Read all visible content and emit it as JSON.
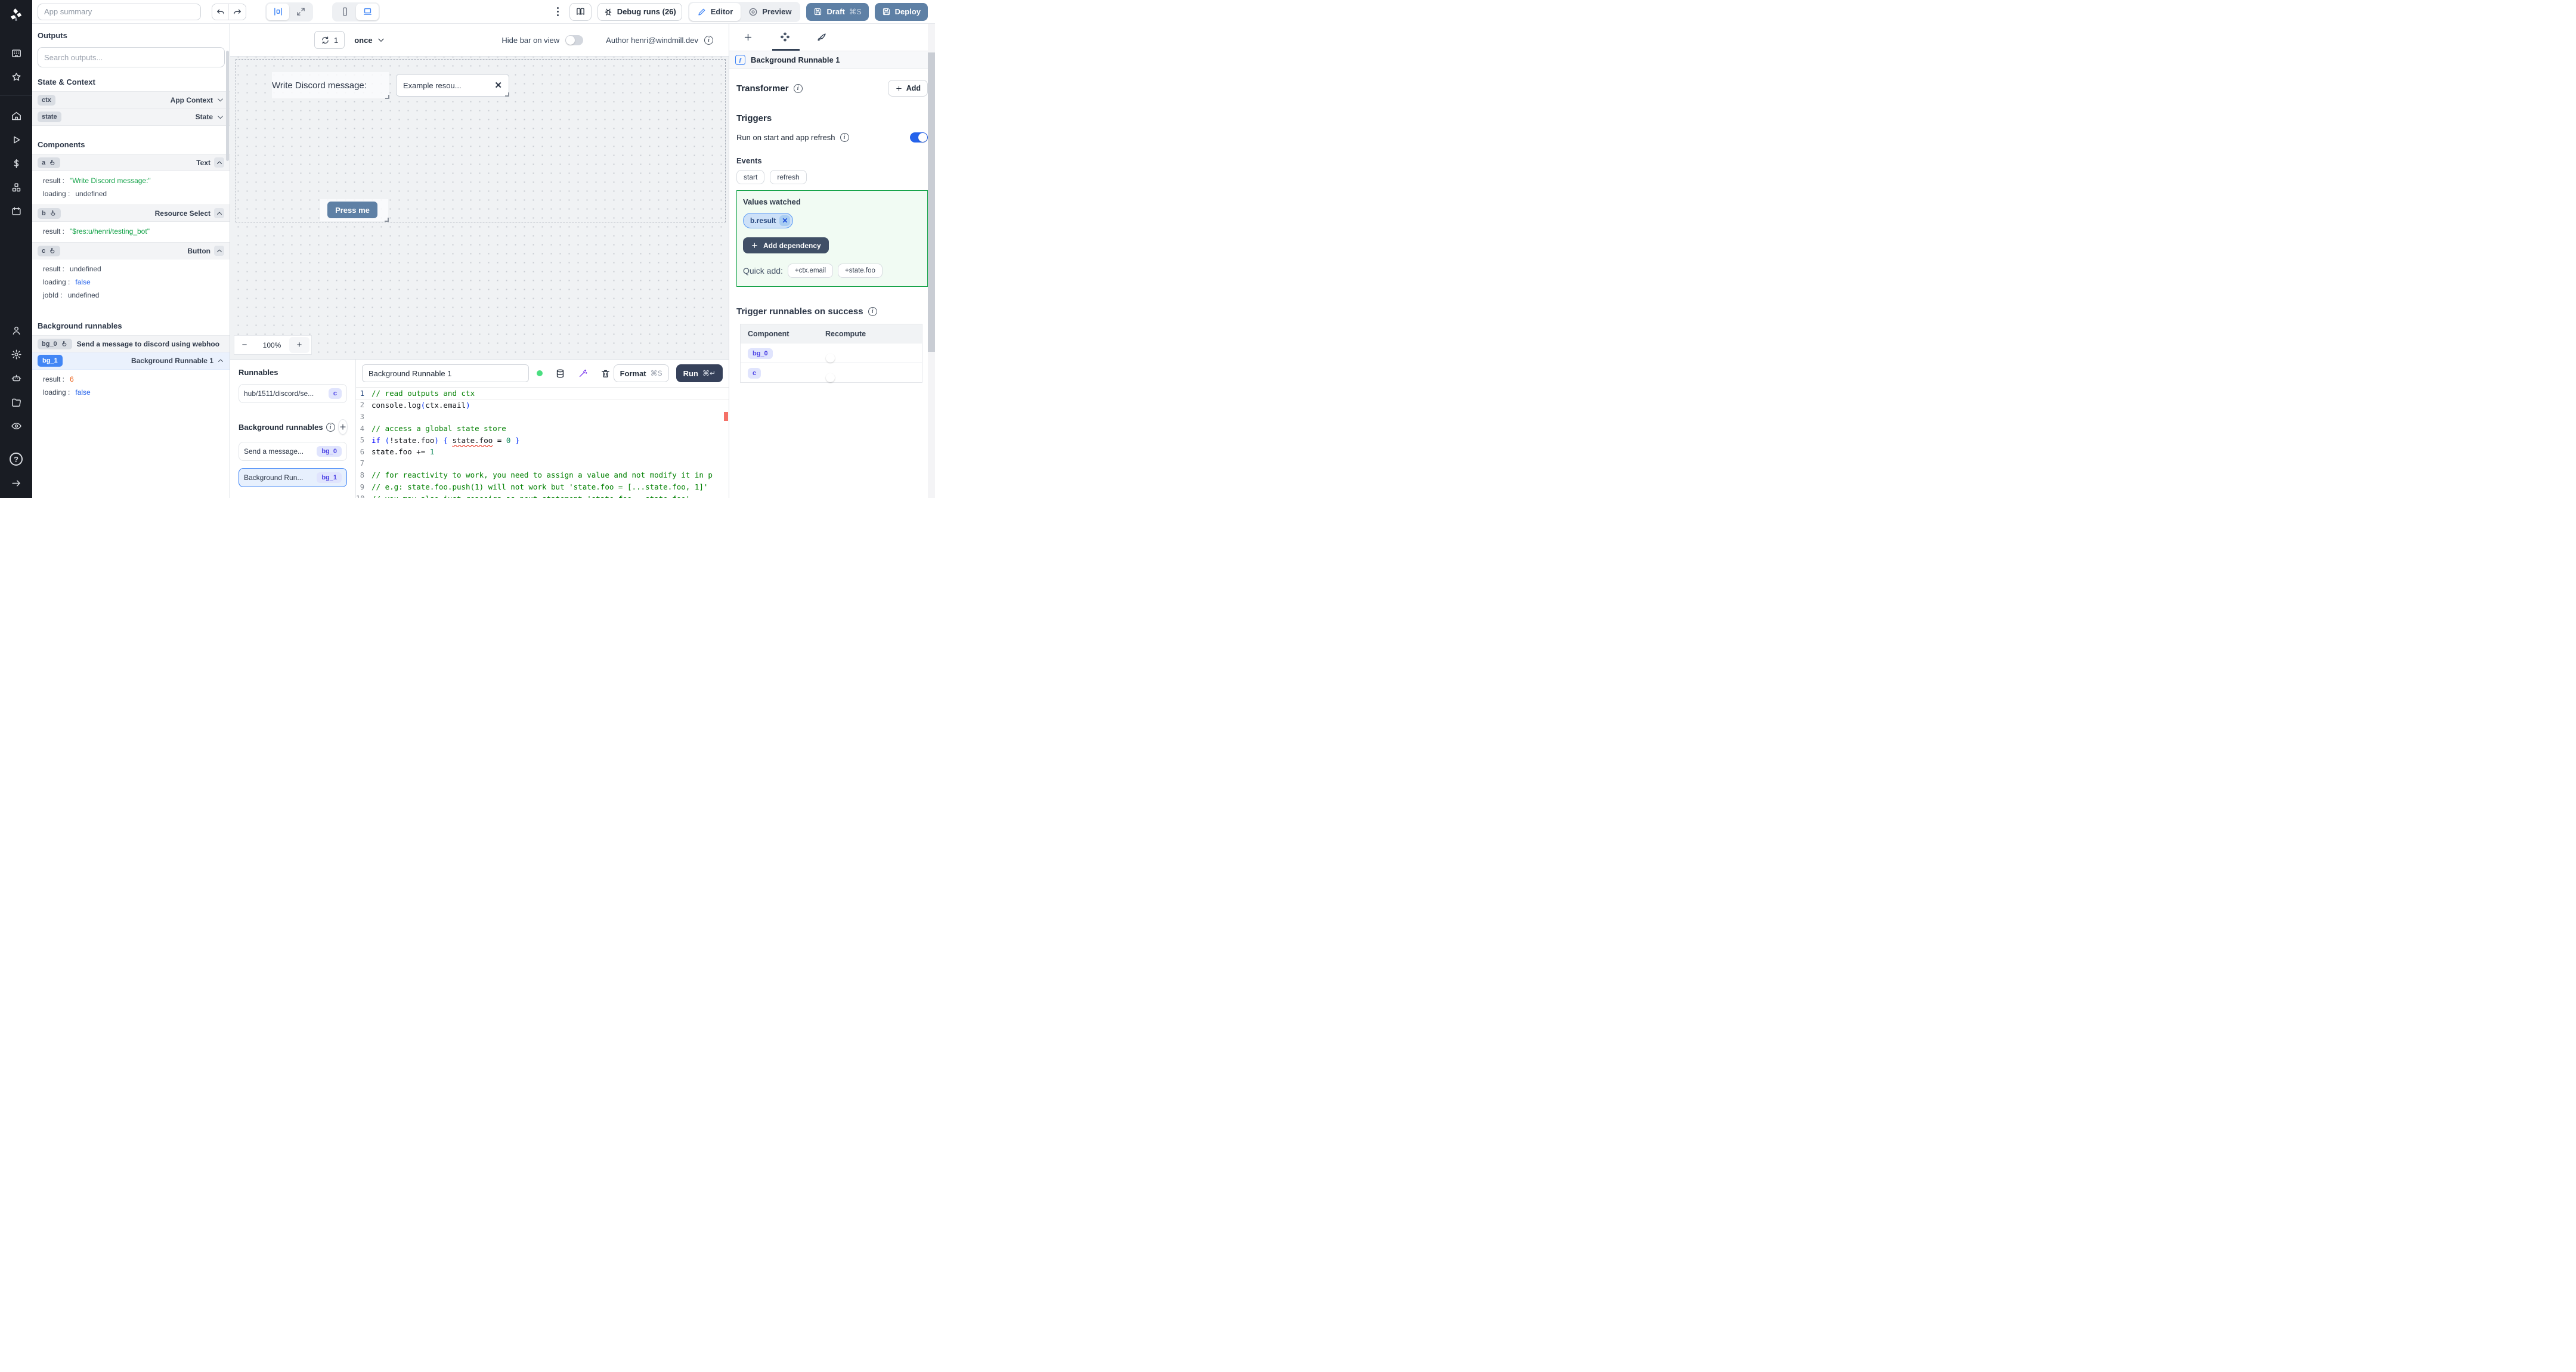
{
  "topbar": {
    "app_summary_placeholder": "App summary",
    "debug_runs_label": "Debug runs (26)",
    "editor_label": "Editor",
    "preview_label": "Preview",
    "draft_label": "Draft",
    "draft_shortcut": "⌘S",
    "deploy_label": "Deploy"
  },
  "sidebar_icons": [
    "windmill-logo",
    "apps",
    "star",
    "home",
    "play",
    "dollar",
    "cubes",
    "calendar",
    "user",
    "gear",
    "robot",
    "folder",
    "eye",
    "help",
    "arrow-right"
  ],
  "outputs": {
    "title": "Outputs",
    "search_placeholder": "Search outputs...",
    "state_context_title": "State & Context",
    "ctx": {
      "badge": "ctx",
      "type": "App Context"
    },
    "state": {
      "badge": "state",
      "type": "State"
    },
    "components_title": "Components",
    "comp_a": {
      "badge": "a",
      "type": "Text",
      "fields": [
        {
          "key": "result",
          "value": "\"Write Discord message:\""
        },
        {
          "key": "loading",
          "value": "undefined"
        }
      ]
    },
    "comp_b": {
      "badge": "b",
      "type": "Resource Select",
      "fields": [
        {
          "key": "result",
          "value": "\"$res:u/henri/testing_bot\""
        }
      ]
    },
    "comp_c": {
      "badge": "c",
      "type": "Button",
      "fields": [
        {
          "key": "result",
          "value": "undefined"
        },
        {
          "key": "loading",
          "value": "false"
        },
        {
          "key": "jobId",
          "value": "undefined"
        }
      ]
    },
    "background_title": "Background runnables",
    "bg0": {
      "badge": "bg_0",
      "label": "Send a message to discord using webhoo"
    },
    "bg1": {
      "badge": "bg_1",
      "label": "Background Runnable 1",
      "fields": [
        {
          "key": "result",
          "value": "6"
        },
        {
          "key": "loading",
          "value": "false"
        }
      ]
    }
  },
  "canvas": {
    "refresh_count": "1",
    "frequency_value": "once",
    "hide_bar_label": "Hide bar on view",
    "author_label": "Author henri@windmill.dev",
    "text_component": "Write Discord message:",
    "select_value": "Example resou...",
    "select_clear": "✕",
    "button_label": "Press me",
    "zoom_out": "−",
    "zoom_value": "100%",
    "zoom_in": "+"
  },
  "runnables": {
    "title": "Runnables",
    "hub_item": {
      "label": "hub/1511/discord/se...",
      "badge": "c"
    },
    "background_title": "Background runnables",
    "items": [
      {
        "label": "Send a message...",
        "badge": "bg_0"
      },
      {
        "label": "Background Run...",
        "badge": "bg_1"
      }
    ]
  },
  "editor": {
    "name_value": "Background Runnable 1",
    "format_label": "Format",
    "format_shortcut": "⌘S",
    "run_label": "Run",
    "run_shortcut": "⌘↵",
    "code": [
      {
        "num": "1",
        "segments": [
          {
            "text": "// read outputs and ctx",
            "cls": "c-comment"
          }
        ]
      },
      {
        "num": "2",
        "segments": [
          {
            "text": "console.log",
            "cls": "c-plain"
          },
          {
            "text": "(",
            "cls": "c-paren"
          },
          {
            "text": "ctx.email",
            "cls": "c-plain"
          },
          {
            "text": ")",
            "cls": "c-paren"
          }
        ]
      },
      {
        "num": "3",
        "segments": []
      },
      {
        "num": "4",
        "segments": [
          {
            "text": "// access a global state store",
            "cls": "c-comment"
          }
        ]
      },
      {
        "num": "5",
        "segments": [
          {
            "text": "if",
            "cls": "c-keyword"
          },
          {
            "text": " (",
            "cls": "c-paren"
          },
          {
            "text": "!state.foo",
            "cls": "c-plain"
          },
          {
            "text": ") ",
            "cls": "c-paren"
          },
          {
            "text": "{ ",
            "cls": "c-brace"
          },
          {
            "text": "state.foo",
            "cls": "c-error"
          },
          {
            "text": " = ",
            "cls": "c-plain"
          },
          {
            "text": "0",
            "cls": "c-number"
          },
          {
            "text": " }",
            "cls": "c-brace"
          }
        ]
      },
      {
        "num": "6",
        "segments": [
          {
            "text": "state.foo += ",
            "cls": "c-plain"
          },
          {
            "text": "1",
            "cls": "c-number"
          }
        ]
      },
      {
        "num": "7",
        "segments": []
      },
      {
        "num": "8",
        "segments": [
          {
            "text": "// for reactivity to work, you need to assign a value and not modify it in p",
            "cls": "c-comment"
          }
        ]
      },
      {
        "num": "9",
        "segments": [
          {
            "text": "// e.g: state.foo.push(1) will not work but 'state.foo = [...state.foo, 1]'",
            "cls": "c-comment"
          }
        ]
      },
      {
        "num": "10",
        "segments": [
          {
            "text": "// you may also just reassign as next statement 'state.foo = state.foo'",
            "cls": "c-comment"
          }
        ]
      }
    ]
  },
  "right_panel": {
    "header_title": "Background Runnable 1",
    "transformer_label": "Transformer",
    "add_label": "Add",
    "triggers_title": "Triggers",
    "run_on_start_label": "Run on start and app refresh",
    "events_label": "Events",
    "event_start": "start",
    "event_refresh": "refresh",
    "values_watched_label": "Values watched",
    "watched_chip": "b.result",
    "watched_chip_close": "✕",
    "add_dependency_label": "Add dependency",
    "quick_add_label": "Quick add:",
    "quick_chip_1": "+ctx.email",
    "quick_chip_2": "+state.foo",
    "trigger_success_label": "Trigger runnables on success",
    "table": {
      "col_component": "Component",
      "col_recompute": "Recompute",
      "rows": [
        {
          "badge": "bg_0"
        },
        {
          "badge": "c"
        }
      ]
    }
  },
  "colors": {
    "accent_blue": "#3b82f6",
    "slate_button": "#5e80a5",
    "dark_button": "#404f66",
    "run_button": "#36415a",
    "value_green": "#16a34a",
    "value_blue": "#2563eb",
    "value_orange": "#ea580c",
    "green_box_border": "#17a34a",
    "badge_blue": "#4286f5",
    "indigo_chip_text": "#4f46e5",
    "error_red": "#e51400"
  }
}
